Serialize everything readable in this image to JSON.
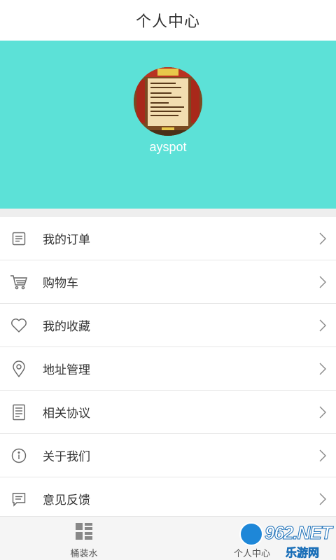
{
  "header": {
    "title": "个人中心"
  },
  "profile": {
    "username": "ayspot",
    "avatar_icon": "avatar-image",
    "background_color": "#5ce1d7"
  },
  "menu": {
    "items": [
      {
        "label": "我的订单",
        "icon": "order-list-icon"
      },
      {
        "label": "购物车",
        "icon": "shopping-cart-icon"
      },
      {
        "label": "我的收藏",
        "icon": "heart-icon"
      },
      {
        "label": "地址管理",
        "icon": "location-pin-icon"
      },
      {
        "label": "相关协议",
        "icon": "document-icon"
      },
      {
        "label": "关于我们",
        "icon": "info-icon"
      },
      {
        "label": "意见反馈",
        "icon": "feedback-icon"
      }
    ]
  },
  "tabbar": {
    "tabs": [
      {
        "label": "桶装水",
        "icon": "grid-icon"
      },
      {
        "label": "个人中心",
        "icon": "person-icon"
      }
    ]
  },
  "watermark": {
    "main": "962.NET",
    "sub": "乐游网"
  }
}
